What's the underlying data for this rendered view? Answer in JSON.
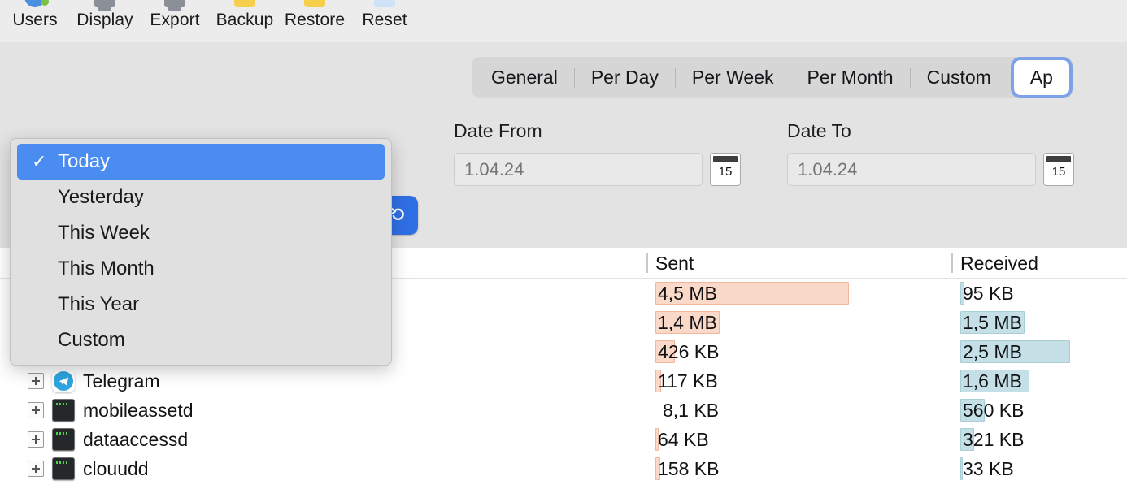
{
  "toolbar": {
    "items": [
      {
        "label": "Users",
        "icon": "users-icon"
      },
      {
        "label": "Display",
        "icon": "display-icon"
      },
      {
        "label": "Export",
        "icon": "export-icon"
      },
      {
        "label": "Backup",
        "icon": "backup-icon"
      },
      {
        "label": "Restore",
        "icon": "restore-icon"
      },
      {
        "label": "Reset",
        "icon": "reset-icon"
      }
    ]
  },
  "tabs": {
    "items": [
      {
        "label": "General",
        "active": false
      },
      {
        "label": "Per Day",
        "active": false
      },
      {
        "label": "Per Week",
        "active": false
      },
      {
        "label": "Per Month",
        "active": false
      },
      {
        "label": "Custom",
        "active": false
      },
      {
        "label": "Ap",
        "active": true
      }
    ]
  },
  "filters": {
    "date_from": {
      "label": "Date From",
      "value": "",
      "placeholder": "1.04.24",
      "calendar_day": "15"
    },
    "date_to": {
      "label": "Date To",
      "value": "",
      "placeholder": "1.04.24",
      "calendar_day": "15"
    },
    "refresh_icon": "refresh-icon"
  },
  "period_menu": {
    "items": [
      {
        "label": "Today",
        "selected": true,
        "check": "✓"
      },
      {
        "label": "Yesterday",
        "selected": false,
        "check": ""
      },
      {
        "label": "This Week",
        "selected": false,
        "check": ""
      },
      {
        "label": "This Month",
        "selected": false,
        "check": ""
      },
      {
        "label": "This Year",
        "selected": false,
        "check": ""
      },
      {
        "label": "Custom",
        "selected": false,
        "check": ""
      }
    ]
  },
  "table": {
    "columns": [
      {
        "key": "name",
        "label": ""
      },
      {
        "key": "sent",
        "label": "Sent"
      },
      {
        "key": "received",
        "label": "Received"
      }
    ],
    "rows": [
      {
        "name": "",
        "icon": "",
        "sent": "4,5 MB",
        "received": "95 KB",
        "sent_bar_w": 238,
        "recv_bar_w": 5,
        "hidden_name": true
      },
      {
        "name": "",
        "icon": "",
        "sent": "1,4 MB",
        "received": "1,5 MB",
        "sent_bar_w": 79,
        "recv_bar_w": 79,
        "hidden_name": true
      },
      {
        "name": "",
        "icon": "",
        "sent": "426 KB",
        "received": "2,5 MB",
        "sent_bar_w": 24,
        "recv_bar_w": 135,
        "hidden_name": true
      },
      {
        "name": "Telegram",
        "icon": "telegram-icon",
        "sent": "117 KB",
        "received": "1,6 MB",
        "sent_bar_w": 7,
        "recv_bar_w": 85
      },
      {
        "name": "mobileassetd",
        "icon": "terminal-icon",
        "sent": "8,1 KB",
        "received": "560 KB",
        "sent_bar_w": 0,
        "recv_bar_w": 30
      },
      {
        "name": "dataaccessd",
        "icon": "terminal-icon",
        "sent": "64 KB",
        "received": "321 KB",
        "sent_bar_w": 4,
        "recv_bar_w": 17
      },
      {
        "name": "clouudd",
        "icon": "terminal-icon",
        "sent": "158 KB",
        "received": "33 KB",
        "sent_bar_w": 6,
        "recv_bar_w": 3
      }
    ]
  },
  "colors": {
    "sent_bar": "#fad9c9",
    "sent_bar_border": "#f2b79c",
    "received_bar": "#c4dfe5",
    "received_bar_border": "#a9ced6",
    "accent_blue": "#4a8cf0",
    "focus_ring": "#7ea2e8",
    "panel_bg": "#e3e3e3",
    "toolbar_bg": "#ececec"
  }
}
